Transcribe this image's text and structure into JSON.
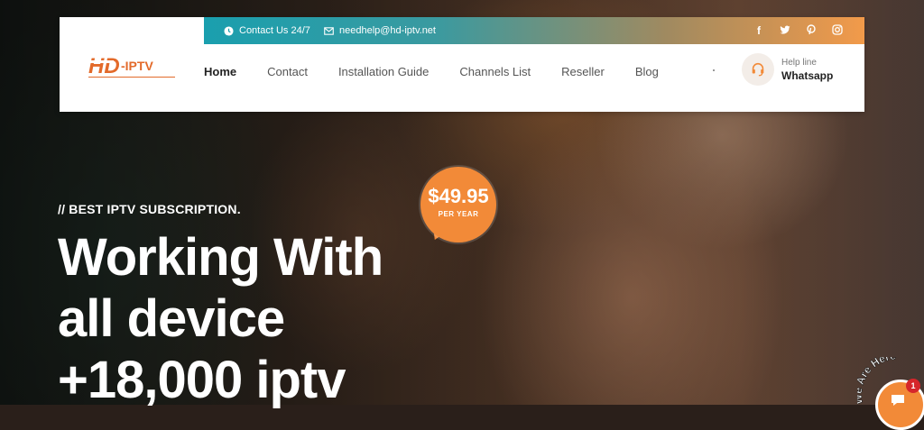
{
  "topbar": {
    "contact": "Contact Us 24/7",
    "email": "needhelp@hd-iptv.net"
  },
  "social_icons": [
    "facebook-icon",
    "twitter-icon",
    "pinterest-icon",
    "instagram-icon"
  ],
  "logo": {
    "text": "HD-IPTV"
  },
  "nav": {
    "items": [
      "Home",
      "Contact",
      "Installation Guide",
      "Channels List",
      "Reseller",
      "Blog"
    ],
    "active": "Home"
  },
  "helpline": {
    "label": "Help line",
    "value": "Whatsapp"
  },
  "hero": {
    "tagline": "// BEST IPTV SUBSCRIPTION.",
    "headline": [
      "Working With",
      "all device",
      "+18,000 iptv"
    ]
  },
  "price": {
    "amount": "$49.95",
    "period": "PER YEAR"
  },
  "chat": {
    "label": "We Are Here",
    "badge": "1"
  },
  "colors": {
    "accent": "#f28a38",
    "teal": "#1a9fae"
  }
}
